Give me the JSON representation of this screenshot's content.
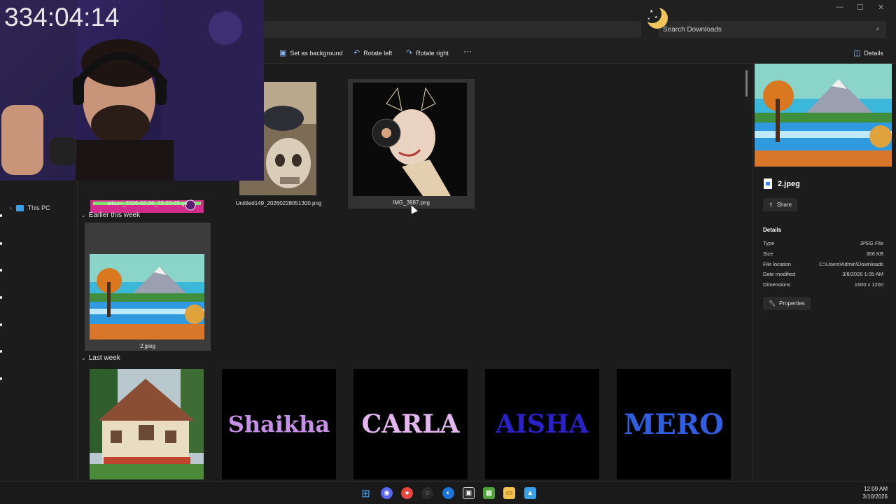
{
  "window": {
    "search_placeholder": "Search Downloads"
  },
  "toolbar": {
    "set_background": "Set as background",
    "rotate_left": "Rotate left",
    "rotate_right": "Rotate right",
    "more": "···",
    "details": "Details"
  },
  "nav": {
    "this_pc": "This PC"
  },
  "groups": {
    "earlier": "Earlier this week",
    "last_week": "Last week"
  },
  "files_top": [
    {
      "name": "album_2026-02-26_23-20-25.gif"
    },
    {
      "name": "Untitled149_20260228051300.png"
    },
    {
      "name": "IMG_3987.png"
    }
  ],
  "files_earlier": [
    {
      "name": "2.jpeg"
    }
  ],
  "files_last_week": [
    {
      "name": "house",
      "text": ""
    },
    {
      "name": "shaikha",
      "text": "Shaikha",
      "color": "#c88fe8"
    },
    {
      "name": "carla",
      "text": "CARLA",
      "color": "#e3b6ef"
    },
    {
      "name": "aisha",
      "text": "AISHA",
      "color": "#2a21c9"
    },
    {
      "name": "mero",
      "text": "MERO",
      "color": "#2f5fe0"
    }
  ],
  "details": {
    "filename": "2.jpeg",
    "share": "Share",
    "section": "Details",
    "rows": [
      {
        "label": "Type",
        "value": "JPEG File"
      },
      {
        "label": "Size",
        "value": "366 KB"
      },
      {
        "label": "File location",
        "value": "C:\\Users\\Admin\\Downloads"
      },
      {
        "label": "Date modified",
        "value": "3/8/2026 1:05 AM"
      },
      {
        "label": "Dimensions",
        "value": "1600 x 1200"
      }
    ],
    "properties": "Properties"
  },
  "overlay": {
    "timer": "334:04:14"
  },
  "taskbar": {
    "time": "12:09 AM",
    "date": "3/10/2026"
  },
  "colors": {
    "accent": "#3b82f6",
    "selection": "#3c3c3c"
  }
}
